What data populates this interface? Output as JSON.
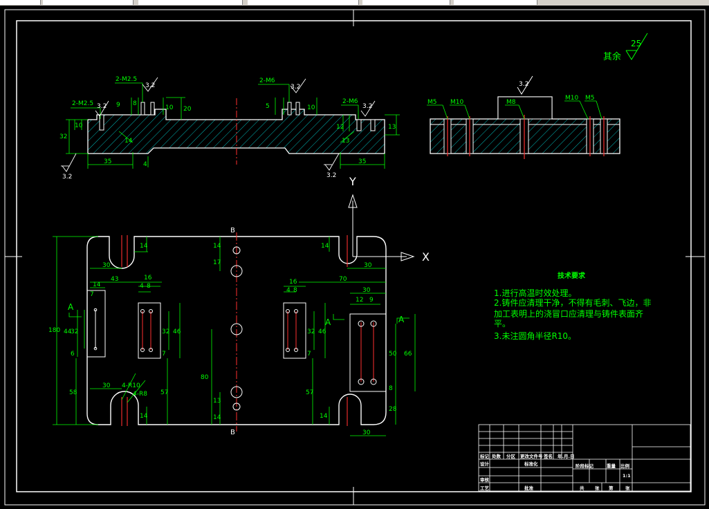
{
  "colors": {
    "background": "#000000",
    "outline": "#ffffff",
    "dimension": "#00ff00",
    "hatch": "#00b8b8",
    "center_line": "#ff3030",
    "roughness": "#ffffff",
    "notes": "#00ff00"
  },
  "surface_finish": {
    "rest_label": "其余",
    "rest_value": "25",
    "general_value": "3.2"
  },
  "views": {
    "front": {
      "labels": {
        "thread_left_outer": "2-M2.5",
        "thread_left_inner": "2-M2.5",
        "thread_right": "2-M6",
        "dim_left_35": "35",
        "dim_right_35": "35",
        "dim_32": "32",
        "dim_4": "4",
        "dim_20": "20",
        "dim_13": "13",
        "dim_10a": "10",
        "dim_10b": "10",
        "dim_10c": "10",
        "dim_8": "8",
        "dim_9": "9",
        "dim_5": "5",
        "dim_12": "12",
        "dim_14": "14",
        "dim_13b": "13",
        "roughness_a": "3.2",
        "roughness_b": "3.2",
        "roughness_c": "3.2",
        "roughness_d": "3.2",
        "roughness_e": "3.2",
        "roughness_f": "3.2"
      }
    },
    "section": {
      "labels": {
        "m5_left": "M5",
        "m10_left": "M10",
        "m8": "M8",
        "m10_right": "M10",
        "m5_right": "M5",
        "roughness": "3.2"
      }
    },
    "plan": {
      "axis_y": "Y",
      "axis_x": "X",
      "section_mark": "B",
      "view_mark": "A",
      "labels": {
        "overall_height": "180",
        "d14_tl": "14",
        "d14_tc": "14",
        "d14_tr": "14",
        "d17": "17",
        "d30_tl": "30",
        "d30_tr": "30",
        "d43": "43",
        "d70": "70",
        "d14_a": "14",
        "d7_a": "7",
        "d16_a": "16",
        "d8_a": "8",
        "d4_a": "4",
        "d16_b": "16",
        "d8_b": "8",
        "d4_b": "4",
        "d30_r": "30",
        "d12": "12",
        "d9": "9",
        "d44": "44",
        "d32_l": "32",
        "d6": "6",
        "d32_c": "32",
        "d46_c": "46",
        "d7_c": "7",
        "d32_r": "32",
        "d46_r": "46",
        "d7_r": "7",
        "d50": "50",
        "d66": "66",
        "d8_r": "8",
        "d80": "80",
        "d13": "13",
        "d14_bc": "14",
        "d58": "58",
        "d30_bl": "30",
        "d4r10": "4-R10",
        "d4r8": "4-R8",
        "d57_l": "57",
        "d57_r": "57",
        "d14_bl": "14",
        "d14_br": "14",
        "d28": "28",
        "d30_br": "30"
      }
    }
  },
  "technical_notes": {
    "title": "技术要求",
    "items": [
      "1.进行高温时效处理。",
      "2.铸件应清理干净，不得有毛刺、飞边，非",
      "加工表明上的浇冒口应清理与铸件表面齐",
      "平。",
      "3.未注圆角半径R10。"
    ]
  },
  "title_block": {
    "header_row": [
      "标记",
      "处数",
      "分区",
      "更改文件号",
      "签名",
      "年.月.日"
    ],
    "design": "设计",
    "standardize": "标准化",
    "review": "审核",
    "process": "工艺",
    "approve": "批准",
    "stage": "阶段标记",
    "weight": "重量",
    "scale_label": "比例",
    "scale": "1:1",
    "sheets": "共",
    "sheet_no": "张",
    "sheet": "第",
    "sheet_end": "张"
  }
}
